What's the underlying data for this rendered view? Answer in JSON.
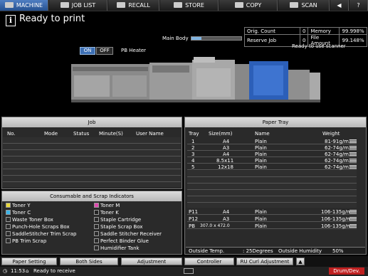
{
  "tabs": [
    {
      "label": "MACHINE"
    },
    {
      "label": "JOB LIST"
    },
    {
      "label": "RECALL"
    },
    {
      "label": "STORE"
    },
    {
      "label": "COPY"
    },
    {
      "label": "SCAN"
    }
  ],
  "status": {
    "title": "Ready to print",
    "scanner": "Ready to use scanner"
  },
  "counters": {
    "orig_count_label": "Orig. Count",
    "orig_count": "0",
    "memory_label": "Memory",
    "memory": "99.998%",
    "reserve_job_label": "Reserve Job",
    "reserve_job": "0",
    "file_amount_label": "File Amount",
    "file_amount": "99.148%"
  },
  "main_body": {
    "label": "Main Body",
    "level": 0.2
  },
  "heater": {
    "on": "ON",
    "off": "OFF",
    "label": "PB Heater"
  },
  "job": {
    "title": "Job",
    "columns": [
      "No.",
      "Mode",
      "Status",
      "Minute(S)",
      "User Name"
    ]
  },
  "consumables": {
    "title": "Consumable and Scrap Indicators",
    "left": [
      "Toner Y",
      "Toner C",
      "Waste Toner Box",
      "Punch-Hole Scraps Box",
      "SaddleStitcher Trim Scrap",
      "PB Trim Scrap"
    ],
    "right": [
      "Toner M",
      "Toner K",
      "Staple Cartridge",
      "Staple Scrap Box",
      "Saddle Stitcher Receiver",
      "Perfect Binder Glue",
      "Humidifier Tank"
    ]
  },
  "paper_tray": {
    "title": "Paper Tray",
    "columns": [
      "Tray",
      "Size(mm)",
      "Name",
      "Weight"
    ],
    "rows": [
      {
        "tray": "1",
        "size": "A4",
        "name": "Plain",
        "weight": "81-91g/m2"
      },
      {
        "tray": "2",
        "size": "A3",
        "name": "Plain",
        "weight": "62-74g/m2"
      },
      {
        "tray": "3",
        "size": "A4",
        "name": "Plain",
        "weight": "62-74g/m2"
      },
      {
        "tray": "4",
        "size": "8.5x11",
        "name": "Plain",
        "weight": "62-74g/m2"
      },
      {
        "tray": "5",
        "size": "12x18",
        "name": "Plain",
        "weight": "62-74g/m2"
      },
      {
        "tray": "P11",
        "size": "A4",
        "name": "Plain",
        "weight": "106-135g/m2"
      },
      {
        "tray": "P12",
        "size": "A3",
        "name": "Plain",
        "weight": "106-135g/m2"
      },
      {
        "tray": "PB",
        "size": "307.0 x 472.0",
        "name": "Plain",
        "weight": "106-135g/m2"
      }
    ],
    "outside_temp_label": "Outside Temp.",
    "outside_temp": ": 25Degrees",
    "outside_humidity_label": "Outside Humidity",
    "outside_humidity": "50%"
  },
  "footer": {
    "buttons": [
      "Paper Setting",
      "Both Sides",
      "Adjustment",
      "Controller",
      "RU Curl Adjustment"
    ],
    "time": "11:53",
    "status": "Ready to receive",
    "drum": "Drum/Dev."
  }
}
